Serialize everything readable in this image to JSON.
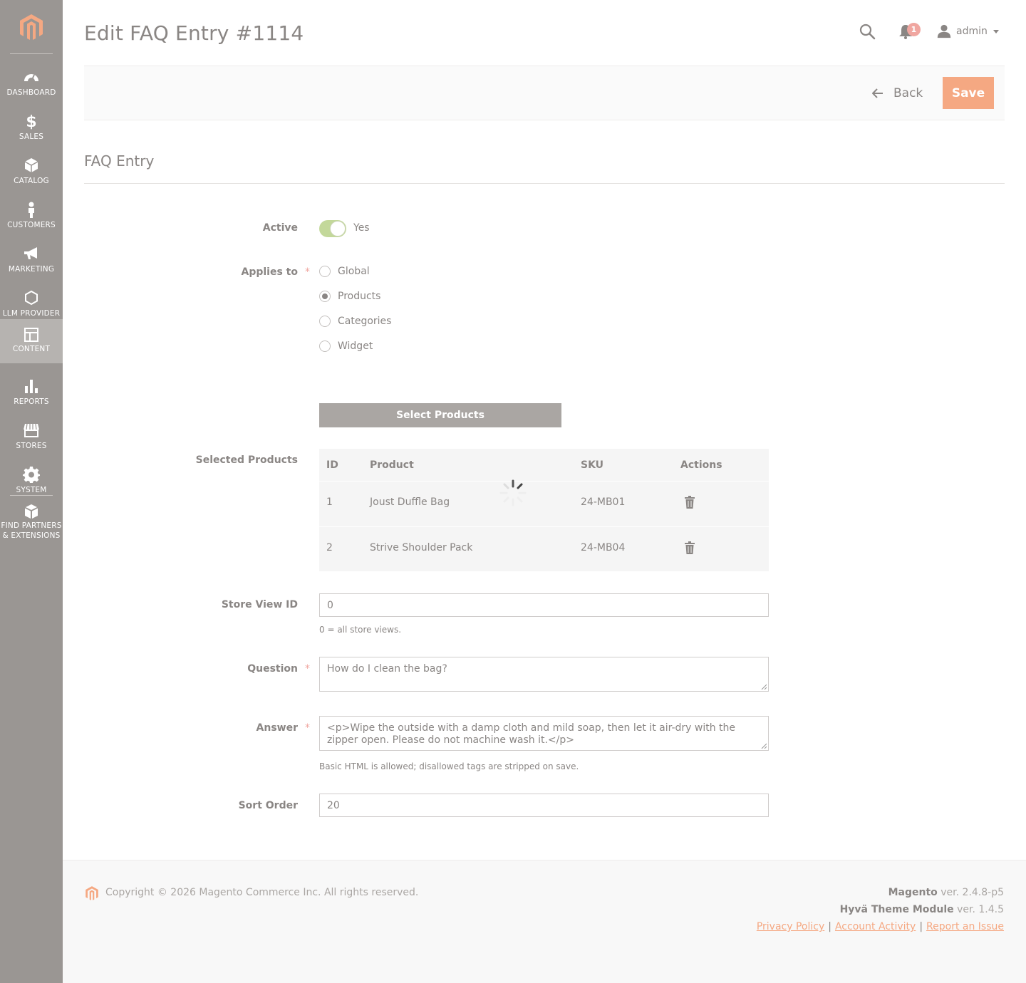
{
  "colors": {
    "sidebar": "#9a9693",
    "accent": "#f5a882",
    "toggle_on": "#c3d89a",
    "badge": "#f0a6a0"
  },
  "sidebar": {
    "items": [
      {
        "label": "DASHBOARD",
        "icon": "dashboard-icon"
      },
      {
        "label": "SALES",
        "icon": "dollar-icon"
      },
      {
        "label": "CATALOG",
        "icon": "box-icon"
      },
      {
        "label": "CUSTOMERS",
        "icon": "person-icon"
      },
      {
        "label": "MARKETING",
        "icon": "megaphone-icon"
      },
      {
        "label": "LLM PROVIDER",
        "icon": "hexagon-icon"
      },
      {
        "label": "CONTENT",
        "icon": "layout-icon",
        "active": true
      },
      {
        "label": "REPORTS",
        "icon": "bar-chart-icon"
      },
      {
        "label": "STORES",
        "icon": "store-icon"
      },
      {
        "label": "SYSTEM",
        "icon": "gear-icon"
      },
      {
        "label_line1": "FIND PARTNERS",
        "label_line2": "& EXTENSIONS",
        "icon": "cubes-icon"
      }
    ]
  },
  "header": {
    "title": "Edit FAQ Entry #1114",
    "notifications": "1",
    "user": "admin"
  },
  "actions": {
    "back": "Back",
    "save": "Save"
  },
  "section": {
    "title": "FAQ Entry"
  },
  "form": {
    "active": {
      "label": "Active",
      "value": "Yes"
    },
    "applies_to": {
      "label": "Applies to",
      "required": "*",
      "options": [
        "Global",
        "Products",
        "Categories",
        "Widget"
      ],
      "selected": "Products"
    },
    "select_products_button": "Select Products",
    "selected_products": {
      "label": "Selected Products",
      "columns": [
        "ID",
        "Product",
        "SKU",
        "Actions"
      ],
      "rows": [
        {
          "id": "1",
          "product": "Joust Duffle Bag",
          "sku": "24-MB01"
        },
        {
          "id": "2",
          "product": "Strive Shoulder Pack",
          "sku": "24-MB04"
        }
      ]
    },
    "store_view_id": {
      "label": "Store View ID",
      "value": "0",
      "note": "0 = all store views."
    },
    "question": {
      "label": "Question",
      "required": "*",
      "value": "How do I clean the bag?"
    },
    "answer": {
      "label": "Answer",
      "required": "*",
      "value": "<p>Wipe the outside with a damp cloth and mild soap, then let it air-dry with the zipper open. Please do not machine wash it.</p>",
      "note": "Basic HTML is allowed; disallowed tags are stripped on save."
    },
    "sort_order": {
      "label": "Sort Order",
      "value": "20"
    }
  },
  "footer": {
    "copyright": "Copyright © 2026 Magento Commerce Inc. All rights reserved.",
    "magento_name": "Magento",
    "magento_ver": " ver. 2.4.8-p5",
    "hyva_name": "Hyvä Theme Module",
    "hyva_ver": " ver. 1.4.5",
    "links": [
      "Privacy Policy",
      "Account Activity",
      "Report an Issue"
    ]
  }
}
